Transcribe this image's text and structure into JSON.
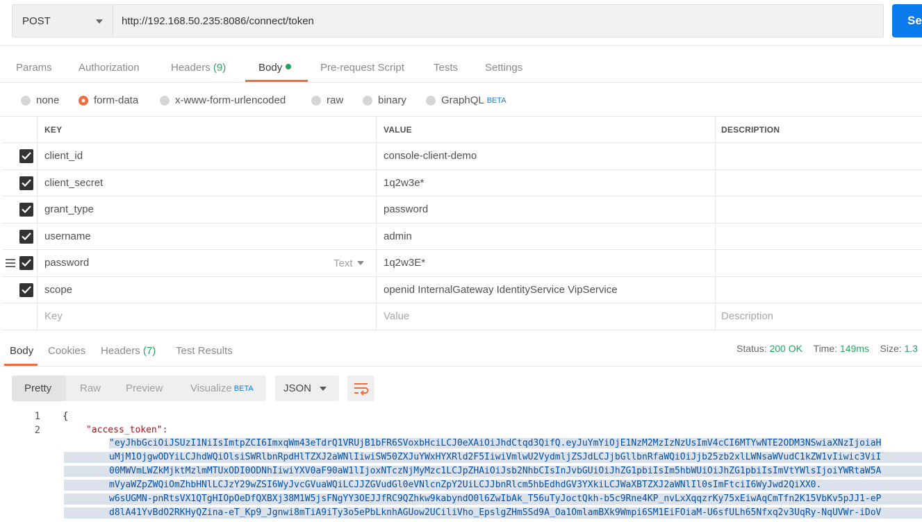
{
  "request": {
    "method": "POST",
    "url": "http://192.168.50.235:8086/connect/token",
    "send_label": "Se"
  },
  "req_tabs": [
    {
      "label": "Params"
    },
    {
      "label": "Authorization"
    },
    {
      "label": "Headers",
      "count": "(9)"
    },
    {
      "label": "Body",
      "active": true
    },
    {
      "label": "Pre-request Script"
    },
    {
      "label": "Tests"
    },
    {
      "label": "Settings"
    }
  ],
  "body_types": [
    {
      "label": "none"
    },
    {
      "label": "form-data",
      "selected": true
    },
    {
      "label": "x-www-form-urlencoded"
    },
    {
      "label": "raw"
    },
    {
      "label": "binary"
    },
    {
      "label": "GraphQL",
      "badge": "BETA"
    }
  ],
  "table": {
    "headers": {
      "key": "KEY",
      "value": "VALUE",
      "description": "DESCRIPTION"
    },
    "rows": [
      {
        "key": "client_id",
        "value": "console-client-demo",
        "checked": true
      },
      {
        "key": "client_secret",
        "value": "1q2w3e*",
        "checked": true
      },
      {
        "key": "grant_type",
        "value": "password",
        "checked": true
      },
      {
        "key": "username",
        "value": "admin",
        "checked": true
      },
      {
        "key": "password",
        "value": "1q2w3E*",
        "checked": true,
        "type_label": "Text"
      },
      {
        "key": "scope",
        "value": "openid InternalGateway IdentityService VipService",
        "checked": true
      }
    ],
    "placeholder": {
      "key": "Key",
      "value": "Value",
      "description": "Description"
    }
  },
  "resp_tabs": [
    {
      "label": "Body",
      "active": true
    },
    {
      "label": "Cookies"
    },
    {
      "label": "Headers",
      "count": "(7)"
    },
    {
      "label": "Test Results"
    }
  ],
  "status": {
    "status_label": "Status:",
    "status_value": "200 OK",
    "time_label": "Time:",
    "time_value": "149ms",
    "size_label": "Size:",
    "size_value": "1.3"
  },
  "view_modes": [
    {
      "label": "Pretty",
      "active": true
    },
    {
      "label": "Raw"
    },
    {
      "label": "Preview"
    },
    {
      "label": "Visualize",
      "badge": "BETA"
    }
  ],
  "format": "JSON",
  "code": {
    "line_numbers": [
      "1",
      "2"
    ],
    "open_brace": "{",
    "access_token_key": "\"access_token\":",
    "token_lines": [
      "\"eyJhbGciOiJSUzI1NiIsImtpZCI6ImxqWm43eTdrQ1VRUjB1bFR6SVoxbHciLCJ0eXAiOiJhdCtqd3QifQ.eyJuYmYiOjE1NzM2MzIzNzUsImV4cCI6MTYwNTE2ODM3NSwiaXNzIjoiaH",
      "uMjM1OjgwODYiLCJhdWQiOlsiSWRlbnRpdHlTZXJ2aWNlIiwiSW50ZXJuYWxHYXRld2F5IiwiVmlwU2VydmljZSJdLCJjbGllbnRfaWQiOiJjb25zb2xlLWNsaWVudC1kZW1vIiwic3ViI",
      "00MWVmLWZkMjktMzlmMTUxODI0ODNhIiwiYXV0aF90aW1lIjoxNTczNjMyMzc1LCJpZHAiOiJsb2NhbCIsInJvbGUiOiJhZG1pbiIsIm5hbWUiOiJhZG1pbiIsImVtYWlsIjoiYWRtaW5A",
      "mVyaWZpZWQiOmZhbHNlLCJzY29wZSI6WyJvcGVuaWQiLCJJZGVudGl0eVNlcnZpY2UiLCJJbnRlcm5hbEdhdGV3YXkiLCJWaXBTZXJ2aWNlIl0sImFtciI6WyJwd2QiXX0.",
      "w6sUGMN-pnRtsVX1QTgHIOpOeDfQXBXj38M1W5jsFNgYY3OEJJfRC9QZhkw9kabyndO0l6ZwIbAk_T56uTyJoctQkh-b5c9Rne4KP_nvLxXqqzrKy75xEiwAqCmTfn2K15VbKv5pJJ1-eP",
      "d8lA41YvBdO2RKHyQZina-eT_Kp9_Jgnwi8mTiA9iTy3o5ePbLknhAGUow2UCiliVho_EpslgZHmSSd9A_Oa1OmlamBXk9Wmpi6SM1EiFOiaM-U6sfULh65Nfxq2v3UqRy-NqUVWr-iDoV"
    ]
  }
}
